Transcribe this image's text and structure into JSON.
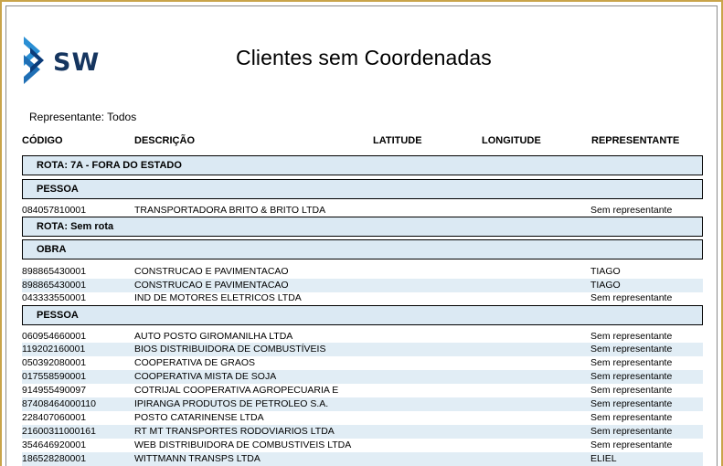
{
  "report": {
    "title": "Clientes sem Coordenadas",
    "filter_label": "Representante: Todos",
    "logo_text": "SW",
    "colors": {
      "group_fill": "#dbe9f3",
      "row_alt": "#e1edf5",
      "logo_blue": "#1f6fb5"
    }
  },
  "columns": {
    "code": "CÓDIGO",
    "description": "DESCRIÇÃO",
    "latitude": "LATITUDE",
    "longitude": "LONGITUDE",
    "representative": "REPRESENTANTE"
  },
  "groups": [
    "ROTA: 7A - FORA DO ESTADO",
    "PESSOA",
    "ROTA: Sem rota",
    "OBRA",
    "PESSOA"
  ],
  "rows": [
    {
      "code": "084057810001",
      "desc": "TRANSPORTADORA BRITO & BRITO LTDA",
      "rep": "Sem representante"
    },
    {
      "code": "898865430001",
      "desc": "CONSTRUCAO E PAVIMENTACAO",
      "rep": "TIAGO"
    },
    {
      "code": "898865430001",
      "desc": "CONSTRUCAO E PAVIMENTACAO",
      "rep": "TIAGO"
    },
    {
      "code": "043333550001",
      "desc": "IND DE MOTORES ELETRICOS LTDA",
      "rep": "Sem representante"
    },
    {
      "code": "060954660001",
      "desc": "AUTO POSTO GIROMANILHA LTDA",
      "rep": "Sem representante"
    },
    {
      "code": "119202160001",
      "desc": "BIOS DISTRIBUIDORA DE COMBUSTÍVEIS",
      "rep": "Sem representante"
    },
    {
      "code": "050392080001",
      "desc": "COOPERATIVA DE GRAOS",
      "rep": "Sem representante"
    },
    {
      "code": "017558590001",
      "desc": "COOPERATIVA MISTA DE SOJA",
      "rep": "Sem representante"
    },
    {
      "code": "914955490097",
      "desc": "COTRIJAL COOPERATIVA AGROPECUARIA E",
      "rep": "Sem representante"
    },
    {
      "code": "87408464000110",
      "desc": "IPIRANGA PRODUTOS DE PETROLEO S.A.",
      "rep": "Sem representante"
    },
    {
      "code": "228407060001",
      "desc": "POSTO CATARINENSE LTDA",
      "rep": "Sem representante"
    },
    {
      "code": "21600311000161",
      "desc": "RT MT TRANSPORTES RODOVIARIOS LTDA",
      "rep": "Sem representante"
    },
    {
      "code": "354646920001",
      "desc": "WEB DISTRIBUIDORA DE COMBUSTIVEIS LTDA",
      "rep": "Sem representante"
    },
    {
      "code": "186528280001",
      "desc": "WITTMANN TRANSPS LTDA",
      "rep": "ELIEL"
    }
  ]
}
